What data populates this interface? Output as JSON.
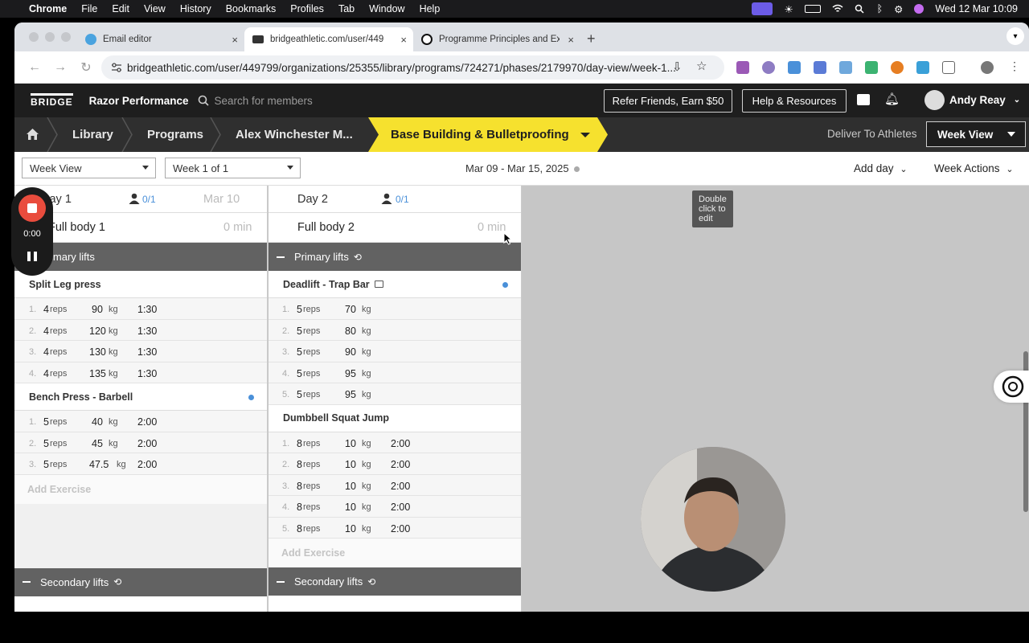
{
  "macos": {
    "menu": [
      "Chrome",
      "File",
      "Edit",
      "View",
      "History",
      "Bookmarks",
      "Profiles",
      "Tab",
      "Window",
      "Help"
    ],
    "datetime": "Wed 12 Mar  10:09"
  },
  "browser": {
    "tabs": [
      {
        "label": "Email editor",
        "fav": "#4aa3df"
      },
      {
        "label": "bridgeathletic.com/user/449",
        "fav": "#333"
      },
      {
        "label": "Programme Principles and Ex",
        "fav": "#111"
      }
    ],
    "url": "bridgeathletic.com/user/449799/organizations/25355/library/programs/724271/phases/2179970/day-view/week-1..."
  },
  "app": {
    "logo": "BRIDGE",
    "org": "Razor Performance",
    "search_placeholder": "Search for members",
    "refer": "Refer Friends, Earn $50",
    "help": "Help & Resources",
    "user": "Andy Reay"
  },
  "crumbs": {
    "library": "Library",
    "programs": "Programs",
    "program": "Alex Winchester M...",
    "phase": "Base Building & Bulletproofing",
    "deliver": "Deliver To Athletes",
    "view": "Week View"
  },
  "filters": {
    "view": "Week View",
    "week": "Week 1 of 1",
    "daterange": "Mar 09 - Mar 15, 2025",
    "add_day": "Add day",
    "week_actions": "Week Actions"
  },
  "recorder": {
    "time": "0:00"
  },
  "tooltip": "Double click to edit",
  "days": [
    {
      "title": "Day 1",
      "assigned": "0/1",
      "date": "Mar 10",
      "workout": "Full body 1",
      "duration": "0 min",
      "segment": "Primary lifts",
      "exercises": [
        {
          "name": "Split Leg press",
          "sets": [
            {
              "n": "1.",
              "reps": "4",
              "load": "90",
              "rest": "1:30"
            },
            {
              "n": "2.",
              "reps": "4",
              "load": "120",
              "rest": "1:30"
            },
            {
              "n": "3.",
              "reps": "4",
              "load": "130",
              "rest": "1:30"
            },
            {
              "n": "4.",
              "reps": "4",
              "load": "135",
              "rest": "1:30"
            }
          ]
        },
        {
          "name": "Bench Press - Barbell",
          "sets": [
            {
              "n": "1.",
              "reps": "5",
              "load": "40",
              "rest": "2:00"
            },
            {
              "n": "2.",
              "reps": "5",
              "load": "45",
              "rest": "2:00"
            },
            {
              "n": "3.",
              "reps": "5",
              "load": "47.5",
              "rest": "2:00"
            }
          ]
        }
      ],
      "add": "Add Exercise",
      "segment2": "Secondary lifts"
    },
    {
      "title": "Day 2",
      "assigned": "0/1",
      "workout": "Full body 2",
      "duration": "0 min",
      "segment": "Primary lifts",
      "exercises": [
        {
          "name": "Deadlift - Trap Bar",
          "sets": [
            {
              "n": "1.",
              "reps": "5",
              "load": "70",
              "rest": ""
            },
            {
              "n": "2.",
              "reps": "5",
              "load": "80",
              "rest": ""
            },
            {
              "n": "3.",
              "reps": "5",
              "load": "90",
              "rest": ""
            },
            {
              "n": "4.",
              "reps": "5",
              "load": "95",
              "rest": ""
            },
            {
              "n": "5.",
              "reps": "5",
              "load": "95",
              "rest": ""
            }
          ]
        },
        {
          "name": "Dumbbell Squat Jump",
          "sets": [
            {
              "n": "1.",
              "reps": "8",
              "load": "10",
              "rest": "2:00"
            },
            {
              "n": "2.",
              "reps": "8",
              "load": "10",
              "rest": "2:00"
            },
            {
              "n": "3.",
              "reps": "8",
              "load": "10",
              "rest": "2:00"
            },
            {
              "n": "4.",
              "reps": "8",
              "load": "10",
              "rest": "2:00"
            },
            {
              "n": "5.",
              "reps": "8",
              "load": "10",
              "rest": "2:00"
            }
          ]
        }
      ],
      "add": "Add Exercise",
      "segment2": "Secondary lifts"
    }
  ],
  "units": {
    "reps": "reps",
    "kg": "kg"
  }
}
